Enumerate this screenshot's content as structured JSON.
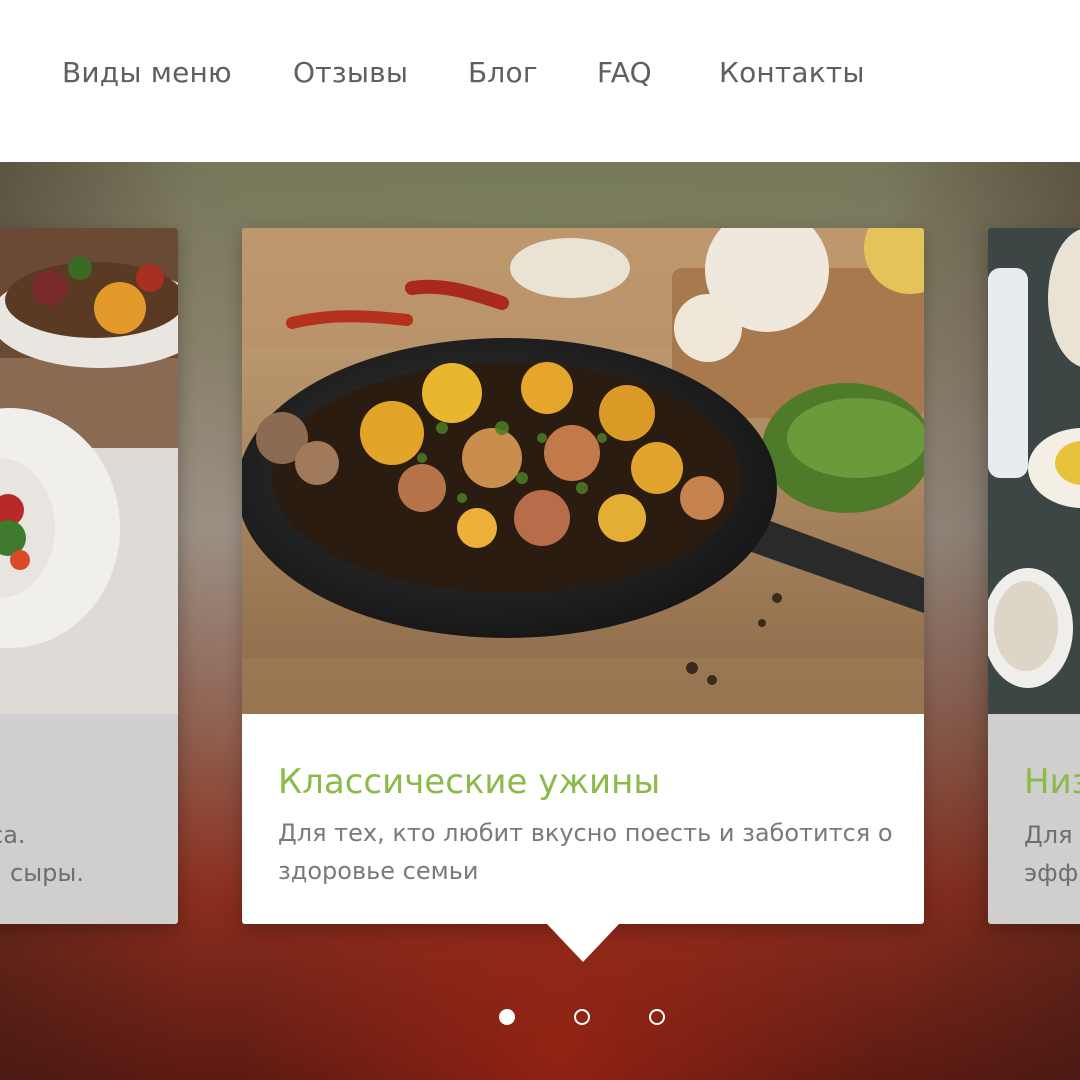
{
  "nav": {
    "items": [
      {
        "label": "Виды меню"
      },
      {
        "label": "Отзывы"
      },
      {
        "label": "Блог"
      },
      {
        "label": "FAQ"
      },
      {
        "label": "Контакты"
      }
    ]
  },
  "slider": {
    "left_card": {
      "desc_line1": "са.",
      "desc_line2": "сыры."
    },
    "center_card": {
      "title": "Классические ужины",
      "desc": "Для тех, кто любит вкусно поесть и заботится о здоровье семьи"
    },
    "right_card": {
      "title": "Низ",
      "desc_line1": "Для",
      "desc_line2": "эфф"
    },
    "dots": {
      "count": 3,
      "active_index": 0
    }
  },
  "colors": {
    "accent_green": "#8cba49",
    "nav_text": "#5f5f5f",
    "desc_text": "#7a7a7a"
  },
  "icons": {
    "dot_active": "filled-circle",
    "dot_idle": "hollow-circle"
  }
}
